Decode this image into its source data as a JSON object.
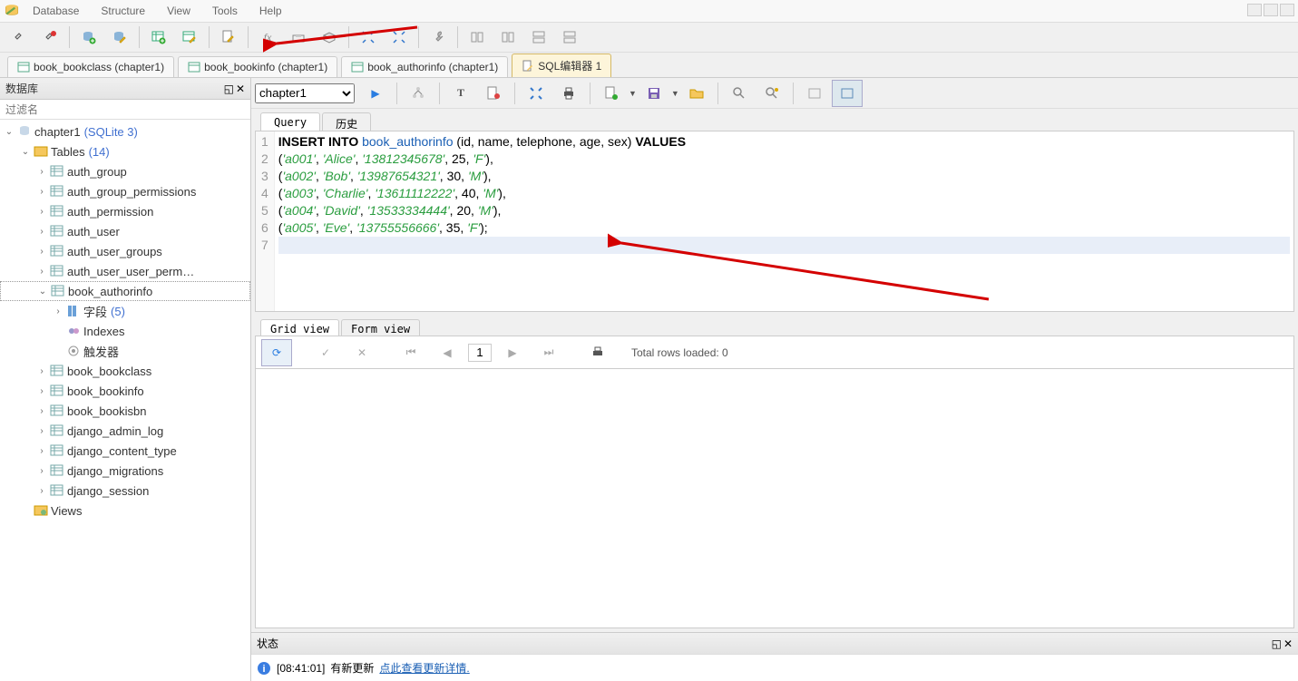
{
  "menubar": [
    "Database",
    "Structure",
    "View",
    "Tools",
    "Help"
  ],
  "sidebar": {
    "title": "数据库",
    "filter_placeholder": "过滤名",
    "db_name": "chapter1",
    "db_engine": "(SQLite 3)",
    "tables_label": "Tables",
    "tables_count": "(14)",
    "tables": [
      "auth_group",
      "auth_group_permissions",
      "auth_permission",
      "auth_user",
      "auth_user_groups",
      "auth_user_user_perm…",
      "book_authorinfo",
      "book_bookclass",
      "book_bookinfo",
      "book_bookisbn",
      "django_admin_log",
      "django_content_type",
      "django_migrations",
      "django_session"
    ],
    "selected_table": "book_authorinfo",
    "fields_label": "字段",
    "fields_count": "(5)",
    "indexes_label": "Indexes",
    "triggers_label": "触发器",
    "views_label": "Views"
  },
  "tabs": [
    {
      "label": "book_bookclass (chapter1)"
    },
    {
      "label": "book_bookinfo (chapter1)"
    },
    {
      "label": "book_authorinfo (chapter1)"
    },
    {
      "label": "SQL编辑器 1",
      "active": true
    }
  ],
  "db_selector": "chapter1",
  "query_tabs": {
    "query": "Query",
    "history": "历史"
  },
  "sql": {
    "lines": [
      {
        "n": 1,
        "tokens": [
          {
            "t": "kw",
            "v": "INSERT INTO "
          },
          {
            "t": "ident",
            "v": "book_authorinfo"
          },
          {
            "t": "",
            "v": " (id, name, telephone, age, sex) "
          },
          {
            "t": "kw",
            "v": "VALUES"
          }
        ]
      },
      {
        "n": 2,
        "tokens": [
          {
            "t": "",
            "v": "("
          },
          {
            "t": "str",
            "v": "'a001'"
          },
          {
            "t": "",
            "v": ", "
          },
          {
            "t": "str",
            "v": "'Alice'"
          },
          {
            "t": "",
            "v": ", "
          },
          {
            "t": "str",
            "v": "'13812345678'"
          },
          {
            "t": "",
            "v": ", 25, "
          },
          {
            "t": "str",
            "v": "'F'"
          },
          {
            "t": "",
            "v": "),"
          }
        ]
      },
      {
        "n": 3,
        "tokens": [
          {
            "t": "",
            "v": "("
          },
          {
            "t": "str",
            "v": "'a002'"
          },
          {
            "t": "",
            "v": ", "
          },
          {
            "t": "str",
            "v": "'Bob'"
          },
          {
            "t": "",
            "v": ", "
          },
          {
            "t": "str",
            "v": "'13987654321'"
          },
          {
            "t": "",
            "v": ", 30, "
          },
          {
            "t": "str",
            "v": "'M'"
          },
          {
            "t": "",
            "v": "),"
          }
        ]
      },
      {
        "n": 4,
        "tokens": [
          {
            "t": "",
            "v": "("
          },
          {
            "t": "str",
            "v": "'a003'"
          },
          {
            "t": "",
            "v": ", "
          },
          {
            "t": "str",
            "v": "'Charlie'"
          },
          {
            "t": "",
            "v": ", "
          },
          {
            "t": "str",
            "v": "'13611112222'"
          },
          {
            "t": "",
            "v": ", 40, "
          },
          {
            "t": "str",
            "v": "'M'"
          },
          {
            "t": "",
            "v": "),"
          }
        ]
      },
      {
        "n": 5,
        "tokens": [
          {
            "t": "",
            "v": "("
          },
          {
            "t": "str",
            "v": "'a004'"
          },
          {
            "t": "",
            "v": ", "
          },
          {
            "t": "str",
            "v": "'David'"
          },
          {
            "t": "",
            "v": ", "
          },
          {
            "t": "str",
            "v": "'13533334444'"
          },
          {
            "t": "",
            "v": ", 20, "
          },
          {
            "t": "str",
            "v": "'M'"
          },
          {
            "t": "",
            "v": "),"
          }
        ]
      },
      {
        "n": 6,
        "tokens": [
          {
            "t": "",
            "v": "("
          },
          {
            "t": "str",
            "v": "'a005'"
          },
          {
            "t": "",
            "v": ", "
          },
          {
            "t": "str",
            "v": "'Eve'"
          },
          {
            "t": "",
            "v": ", "
          },
          {
            "t": "str",
            "v": "'13755556666'"
          },
          {
            "t": "",
            "v": ", 35, "
          },
          {
            "t": "str",
            "v": "'F'"
          },
          {
            "t": "",
            "v": ");"
          }
        ]
      },
      {
        "n": 7,
        "tokens": []
      }
    ]
  },
  "result_tabs": {
    "grid": "Grid view",
    "form": "Form view"
  },
  "result_status": "Total rows loaded: 0",
  "result_page": "1",
  "status": {
    "title": "状态",
    "time": "[08:41:01]",
    "text": "有新更新",
    "link": "点此查看更新详情"
  }
}
